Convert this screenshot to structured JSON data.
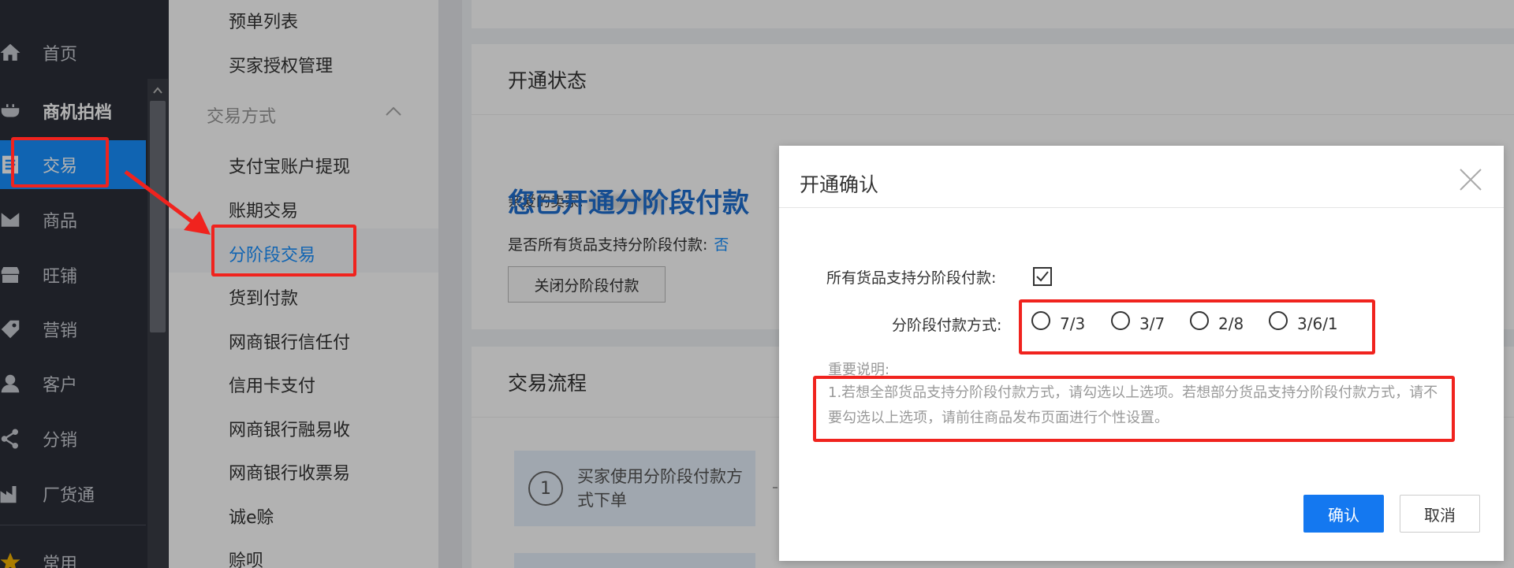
{
  "nav": {
    "items": [
      {
        "label": "首页",
        "icon": "home-icon"
      },
      {
        "label": "商机拍档",
        "icon": "partner-icon"
      },
      {
        "label": "交易",
        "icon": "trade-icon"
      },
      {
        "label": "商品",
        "icon": "goods-icon"
      },
      {
        "label": "旺铺",
        "icon": "shop-icon"
      },
      {
        "label": "营销",
        "icon": "tag-icon"
      },
      {
        "label": "客户",
        "icon": "user-icon"
      },
      {
        "label": "分销",
        "icon": "share-icon"
      },
      {
        "label": "厂货通",
        "icon": "factory-icon"
      },
      {
        "label": "常用",
        "icon": "star-icon"
      }
    ],
    "active_index": 2
  },
  "submenu": {
    "top_items": [
      "预单列表",
      "买家授权管理"
    ],
    "group_title": "交易方式",
    "group_items": [
      "支付宝账户提现",
      "账期交易",
      "分阶段交易",
      "货到付款",
      "网商银行信任付",
      "信用卡支付",
      "网商银行融易收",
      "网商银行收票易",
      "诚e赊",
      "赊呗"
    ],
    "active_item": "分阶段交易"
  },
  "main": {
    "status_card": {
      "title": "开通状态",
      "greeting": "亲爱的卖家:",
      "headline": "您已开通分阶段付款",
      "support_label": "是否所有货品支持分阶段付款:",
      "support_value": "否",
      "close_button": "关闭分阶段付款"
    },
    "flow_card": {
      "title": "交易流程",
      "step1_num": "1",
      "step1_text": "买家使用分阶段付款方式下单"
    }
  },
  "dialog": {
    "title": "开通确认",
    "all_goods_label": "所有货品支持分阶段付款:",
    "all_goods_checked": true,
    "method_label": "分阶段付款方式:",
    "method_options": [
      "7/3",
      "3/7",
      "2/8",
      "3/6/1"
    ],
    "note_title": "重要说明:",
    "note_text": "1.若想全部货品支持分阶段付款方式，请勾选以上选项。若想部分货品支持分阶段付款方式，请不要勾选以上选项，请前往商品发布页面进行个性设置。",
    "confirm": "确认",
    "cancel": "取消"
  },
  "colors": {
    "nav_bg": "#2c2f38",
    "accent": "#1890ff",
    "annotation_red": "#f0231e",
    "confirm_bg": "#1478f0"
  }
}
